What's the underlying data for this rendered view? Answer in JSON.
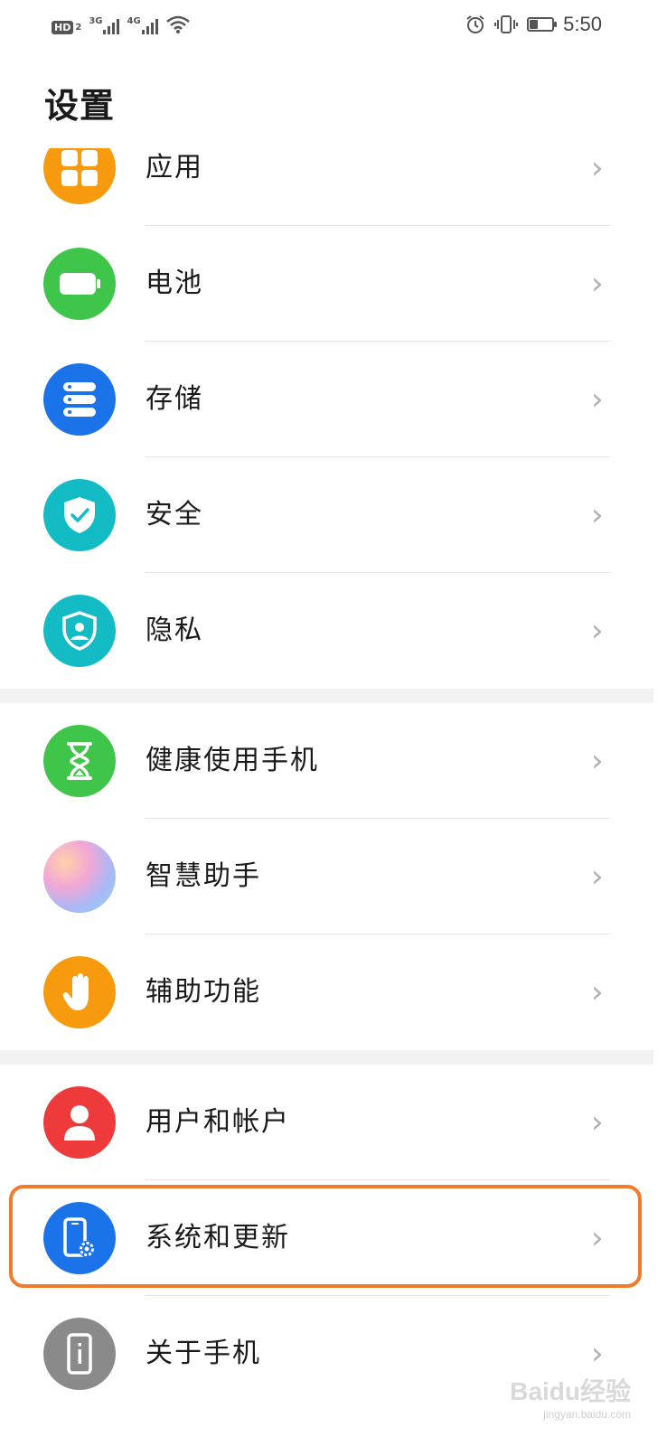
{
  "status_bar": {
    "hd_label": "HD",
    "hd_sim": "2",
    "signal1_type": "3G",
    "signal2_type": "4G",
    "battery_level_percent": 40,
    "time": "5:50"
  },
  "page": {
    "title": "设置"
  },
  "groups": [
    {
      "items": [
        {
          "label": "应用",
          "icon": "apps-icon",
          "color": "#f79a0e"
        },
        {
          "label": "电池",
          "icon": "battery-icon",
          "color": "#3fc54a"
        },
        {
          "label": "存储",
          "icon": "storage-icon",
          "color": "#1a73e8"
        },
        {
          "label": "安全",
          "icon": "shield-check-icon",
          "color": "#13bcc5"
        },
        {
          "label": "隐私",
          "icon": "privacy-icon",
          "color": "#13bcc5"
        }
      ]
    },
    {
      "items": [
        {
          "label": "健康使用手机",
          "icon": "hourglass-icon",
          "color": "#3fc54a"
        },
        {
          "label": "智慧助手",
          "icon": "assistant-icon",
          "color": "#c7a3e8"
        },
        {
          "label": "辅助功能",
          "icon": "hand-icon",
          "color": "#f79a0e"
        }
      ]
    },
    {
      "items": [
        {
          "label": "用户和帐户",
          "icon": "user-icon",
          "color": "#ee3a3a"
        },
        {
          "label": "系统和更新",
          "icon": "system-update-icon",
          "color": "#1a73e8",
          "highlighted": true
        },
        {
          "label": "关于手机",
          "icon": "about-phone-icon",
          "color": "#8a8a8a"
        }
      ]
    }
  ],
  "chevron": "›",
  "watermark": {
    "brand": "Baidu经验",
    "url": "jingyan.baidu.com"
  }
}
